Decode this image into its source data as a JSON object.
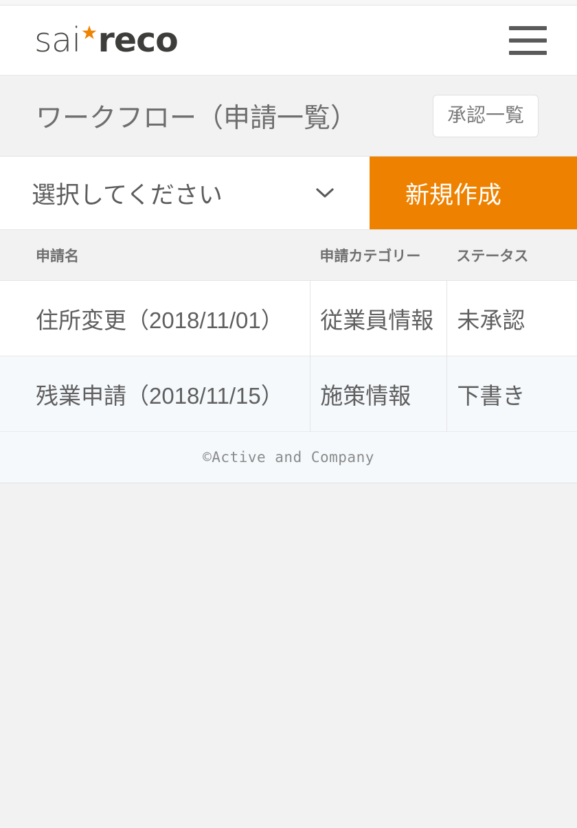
{
  "header": {
    "logo": {
      "part1": "sai",
      "star_icon": "orange-star-icon",
      "part2": "reco",
      "accent_color": "#ef8200"
    },
    "menu_icon": "hamburger-menu-icon"
  },
  "title_bar": {
    "title": "ワークフロー（申請一覧）",
    "approval_button": "承認一覧"
  },
  "controls": {
    "select": {
      "value": "選択してください",
      "placeholder": "選択してください",
      "chevron_icon": "chevron-down-icon"
    },
    "create_button": {
      "label": "新規作成",
      "color": "#ee8200"
    }
  },
  "table": {
    "columns": [
      "申請名",
      "申請カテゴリー",
      "ステータス"
    ],
    "rows": [
      {
        "name": "住所変更（2018/11/01）",
        "category": "従業員情報",
        "status": "未承認"
      },
      {
        "name": "残業申請（2018/11/15）",
        "category": "施策情報",
        "status": "下書き"
      }
    ]
  },
  "footer": {
    "copyright": "©Active and Company"
  }
}
